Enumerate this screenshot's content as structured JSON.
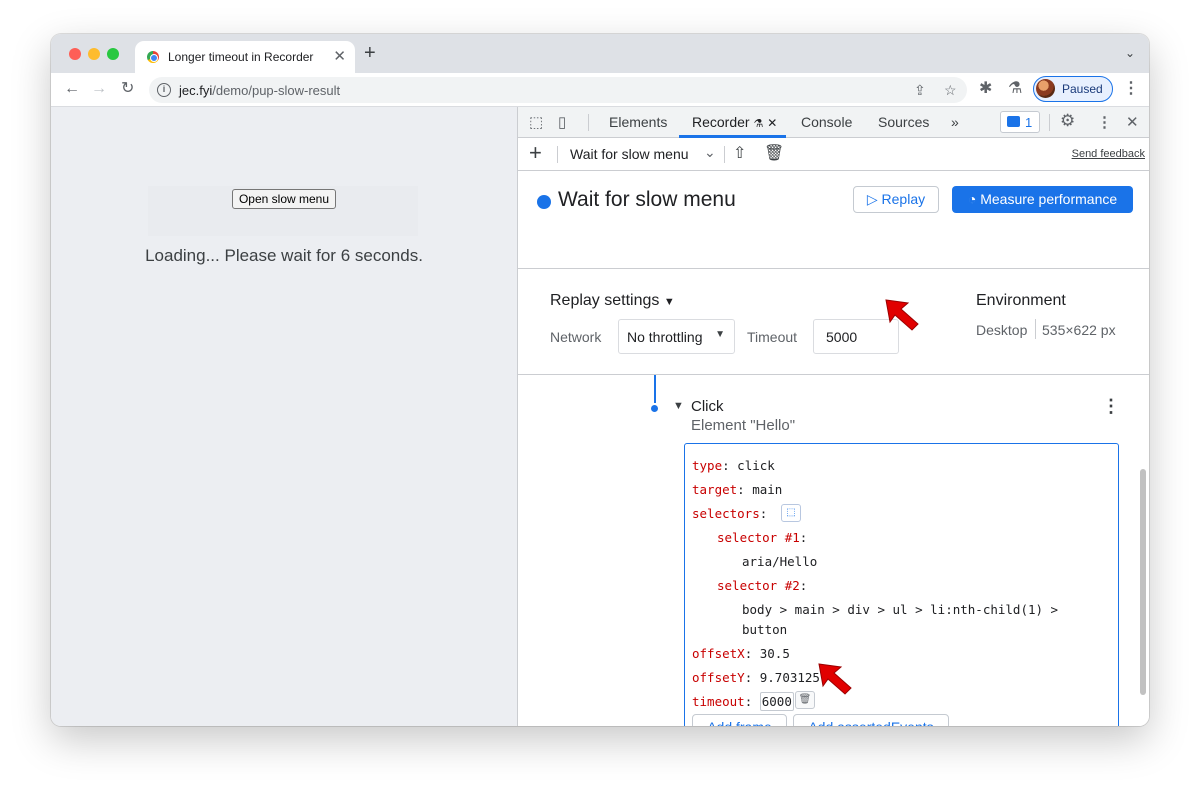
{
  "browser": {
    "tab_title": "Longer timeout in Recorder",
    "tab_close": "✕",
    "new_tab": "+",
    "url_host": "jec.fyi",
    "url_path": "/demo/pup-slow-result",
    "profile_status": "Paused"
  },
  "page": {
    "open_button": "Open slow menu",
    "loading_text": "Loading... Please wait for 6 seconds."
  },
  "devtools": {
    "tabs": [
      "Elements",
      "Recorder",
      "Console",
      "Sources"
    ],
    "active_tab": "Recorder",
    "more_tabs": "»",
    "message_count": "1",
    "recording_select": "Wait for slow menu",
    "send_feedback": "Send feedback",
    "recording_title": "Wait for slow menu",
    "replay_button": "▷ Replay",
    "measure_button": "Measure performance"
  },
  "replay_settings": {
    "title": "Replay settings",
    "network_label": "Network",
    "network_value": "No throttling",
    "timeout_label": "Timeout",
    "timeout_value": "5000"
  },
  "environment": {
    "title": "Environment",
    "device": "Desktop",
    "size": "535×622 px"
  },
  "step": {
    "title": "Click",
    "subtitle": "Element \"Hello\"",
    "type_key": "type",
    "type_value": "click",
    "target_key": "target",
    "target_value": "main",
    "selectors_key": "selectors",
    "selector1_key": "selector #1",
    "selector1_value": "aria/Hello",
    "selector2_key": "selector #2",
    "selector2_line1": "body > main > div > ul > li:nth-child(1) >",
    "selector2_line2": "button",
    "offsetx_key": "offsetX",
    "offsetx_value": "30.5",
    "offsety_key": "offsetY",
    "offsety_value": "9.703125",
    "timeout_key": "timeout",
    "timeout_value": "6000",
    "add_frame": "Add frame",
    "add_asserted_events": "Add assertedEvents"
  },
  "colors": {
    "accent": "#1a73e8",
    "code_key": "#c80000",
    "annotation_arrow": "#e10000"
  }
}
